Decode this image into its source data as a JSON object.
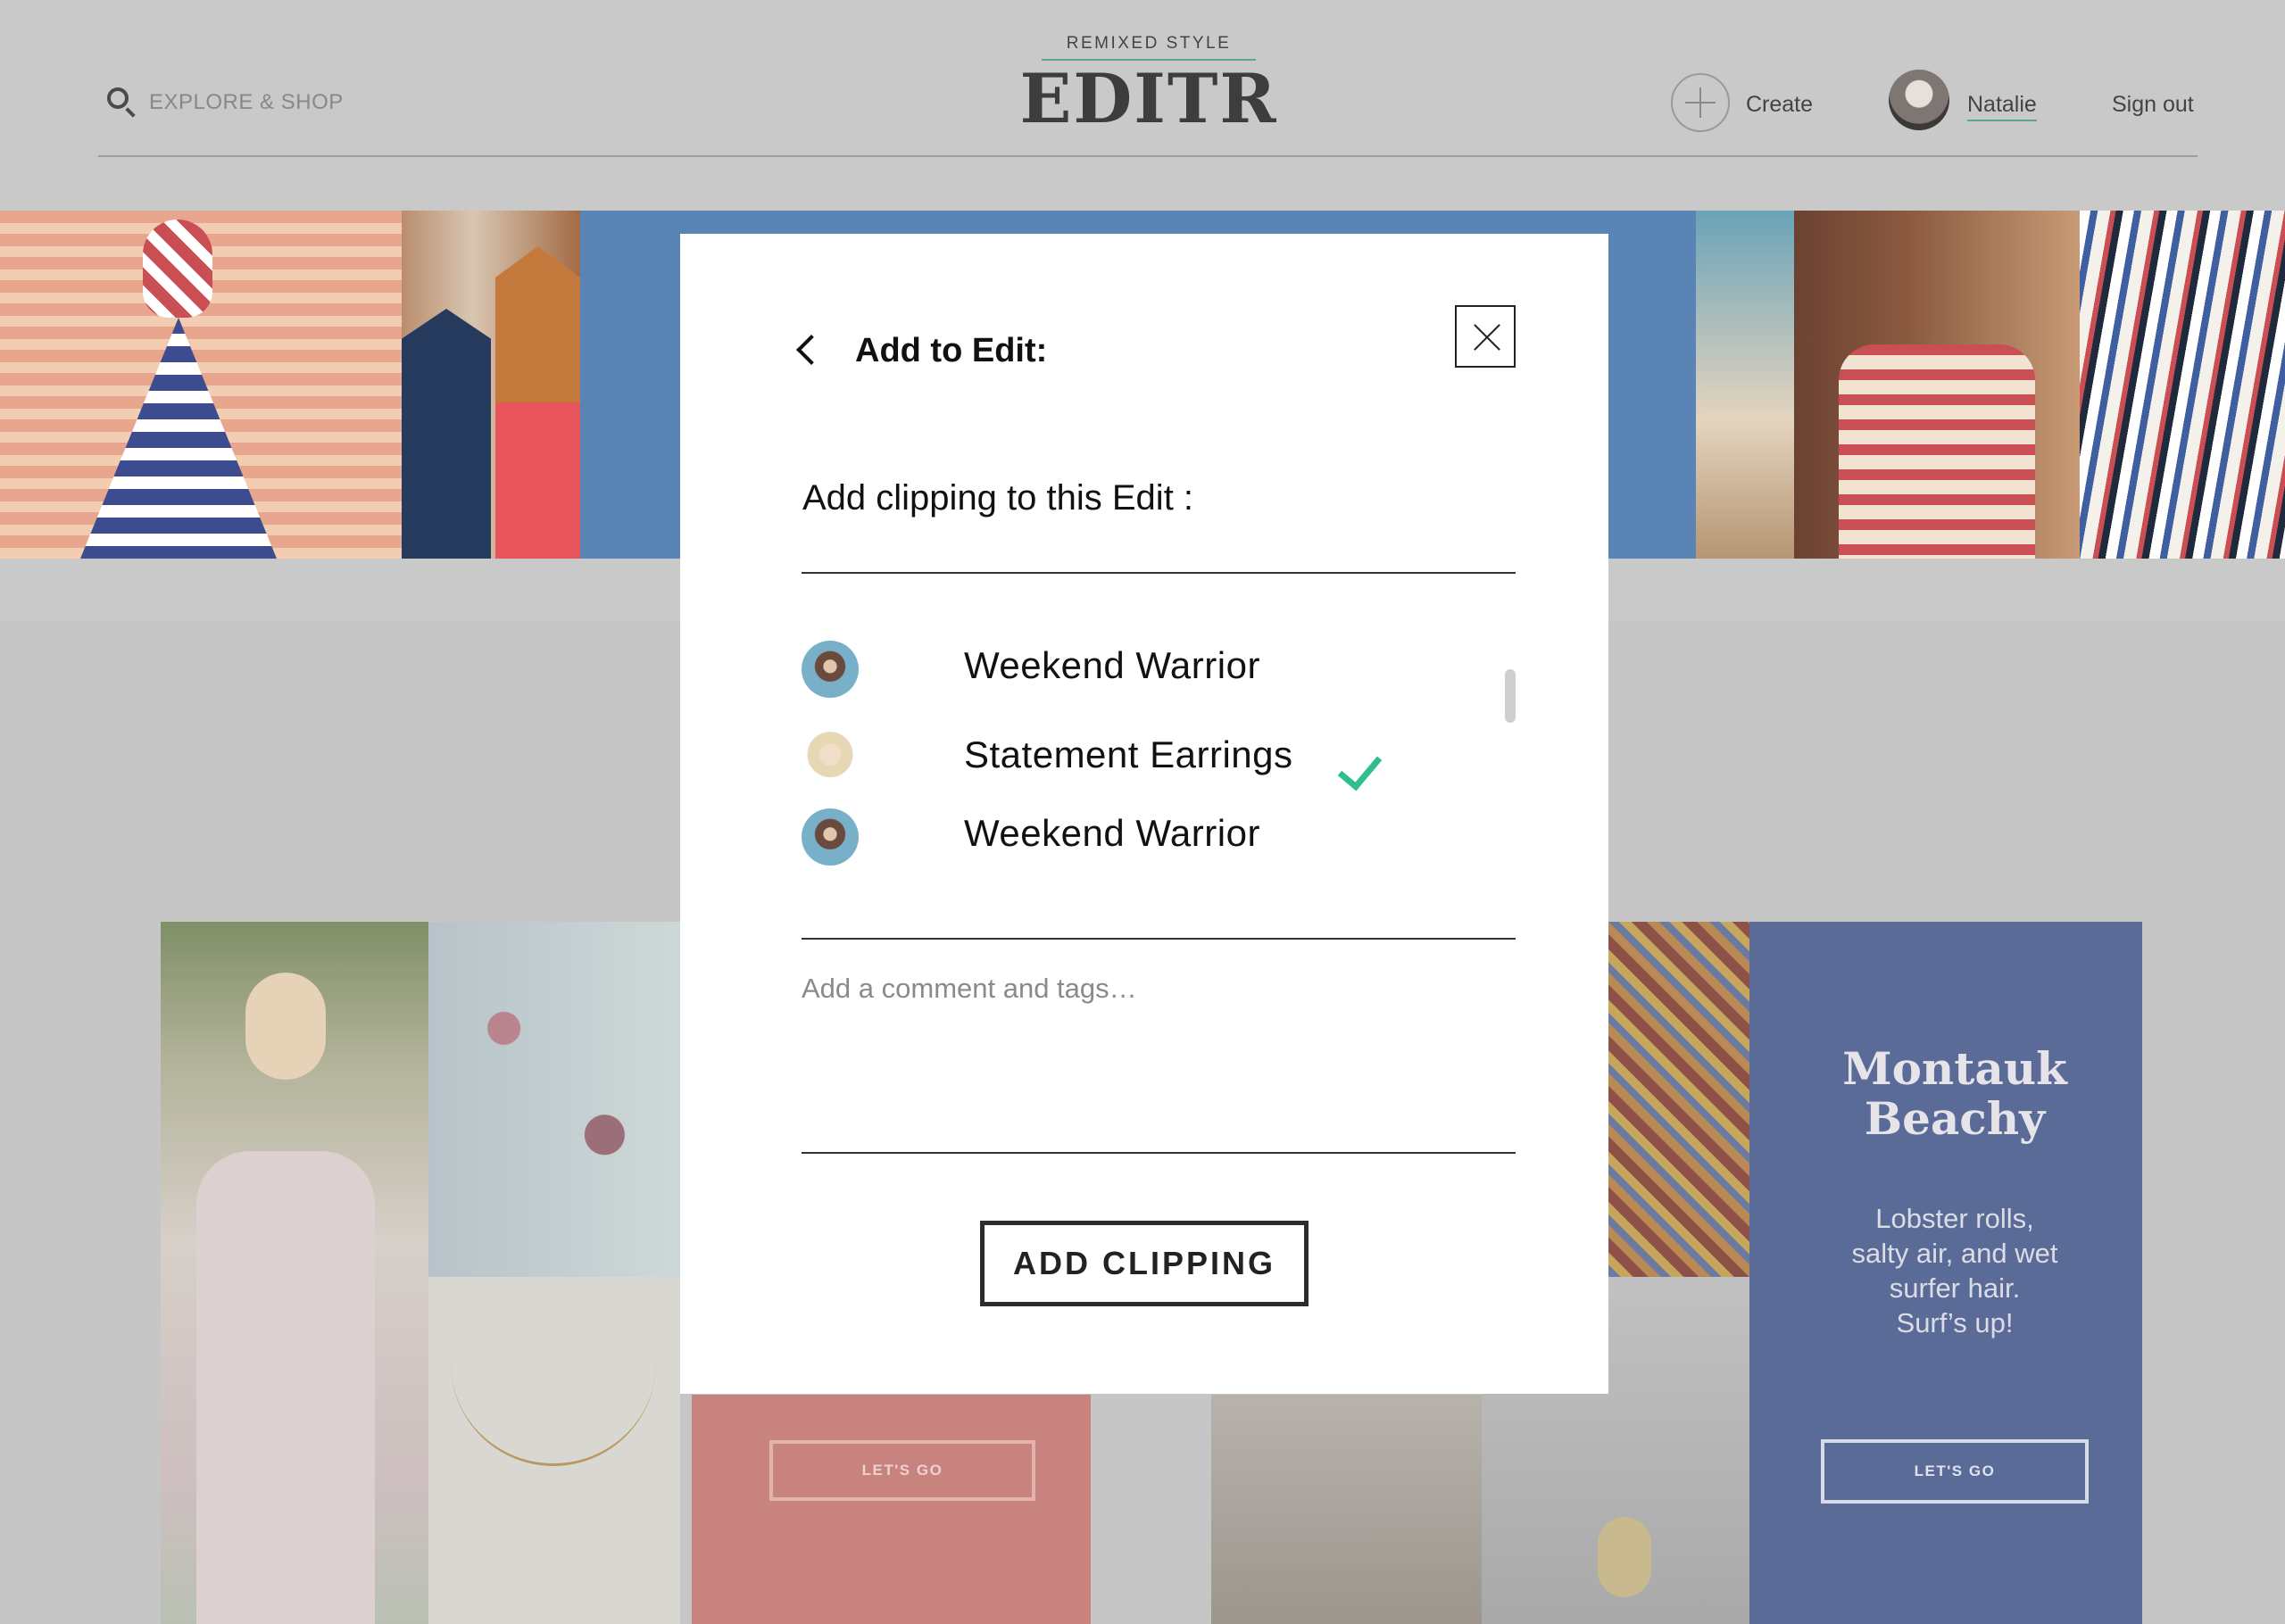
{
  "header": {
    "search_label": "EXPLORE & SHOP",
    "brand_kicker": "REMIXED STYLE",
    "brand_name": "EDITR",
    "create_label": "Create",
    "user_name": "Natalie",
    "signout_label": "Sign out"
  },
  "cards": {
    "salmon_button": "LET'S GO",
    "blue_title_line1": "Montauk",
    "blue_title_line2": "Beachy",
    "blue_body_1": "Lobster rolls,",
    "blue_body_2": "salty air, and wet",
    "blue_body_3": "surfer hair.",
    "blue_body_4": "Surf’s up!",
    "blue_button": "LET'S GO"
  },
  "modal": {
    "title": "Add to Edit:",
    "subtitle": "Add clipping to this Edit :",
    "items": [
      {
        "label": "Weekend Warrior",
        "selected": false
      },
      {
        "label": "Statement Earrings",
        "selected": true
      },
      {
        "label": "Weekend Warrior",
        "selected": false
      }
    ],
    "comment_placeholder": "Add a comment and tags…",
    "submit_label": "ADD CLIPPING"
  },
  "colors": {
    "accent_green": "#2fbf8e",
    "brand_rule": "#5aa78d",
    "card_blue": "#5b6b98",
    "card_salmon": "#c9837f",
    "overlay": "#c9c9c9"
  }
}
